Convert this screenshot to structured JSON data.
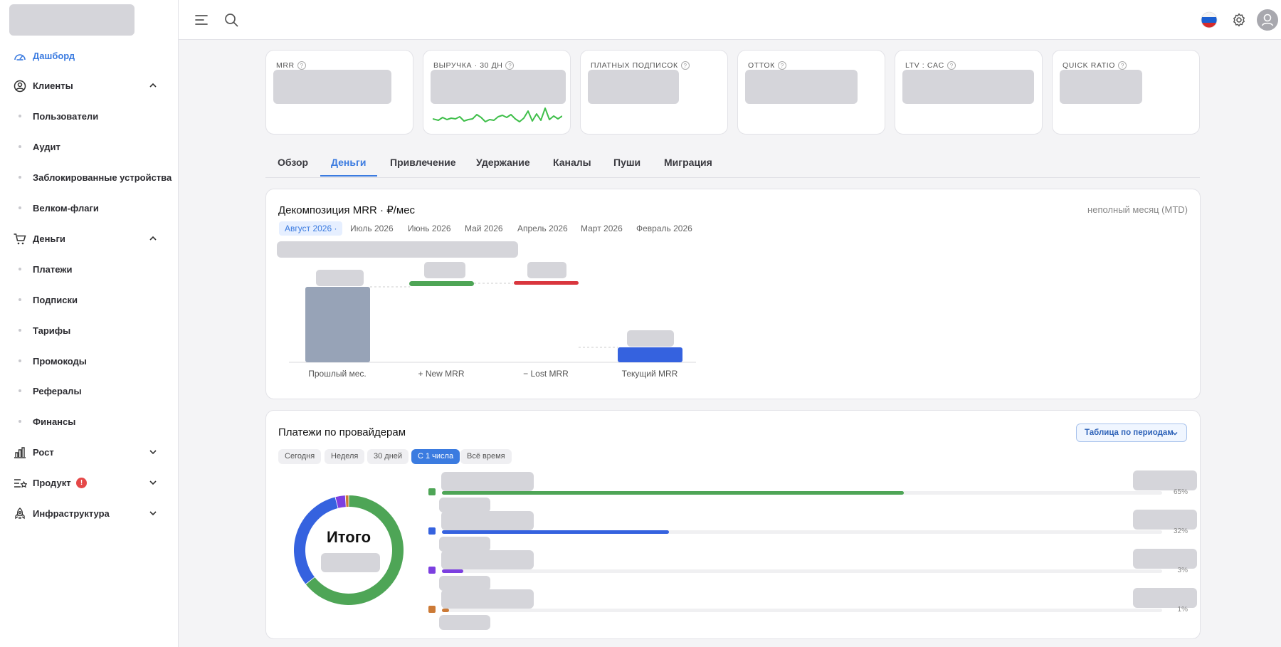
{
  "sidebar": {
    "items": [
      {
        "label": "Дашборд"
      },
      {
        "label": "Клиенты"
      },
      {
        "label": "Пользователи"
      },
      {
        "label": "Аудит"
      },
      {
        "label": "Заблокированные устройства"
      },
      {
        "label": "Велком-флаги"
      },
      {
        "label": "Деньги"
      },
      {
        "label": "Платежи"
      },
      {
        "label": "Подписки"
      },
      {
        "label": "Тарифы"
      },
      {
        "label": "Промокоды"
      },
      {
        "label": "Рефералы"
      },
      {
        "label": "Финансы"
      },
      {
        "label": "Рост"
      },
      {
        "label": "Продукт"
      },
      {
        "label": "Инфраструктура"
      }
    ],
    "product_badge": "!"
  },
  "kpis": [
    {
      "title": "MRR"
    },
    {
      "title": "ВЫРУЧКА · 30 ДН"
    },
    {
      "title": "ПЛАТНЫХ ПОДПИСОК"
    },
    {
      "title": "ОТТОК"
    },
    {
      "title": "LTV : CAC"
    },
    {
      "title": "QUICK RATIO"
    }
  ],
  "help_glyph": "?",
  "tabs": [
    {
      "label": "Обзор"
    },
    {
      "label": "Деньги"
    },
    {
      "label": "Привлечение"
    },
    {
      "label": "Удержание"
    },
    {
      "label": "Каналы"
    },
    {
      "label": "Пуши"
    },
    {
      "label": "Миграция"
    }
  ],
  "mrr_card": {
    "title": "Декомпозиция MRR · ₽/мес",
    "note": "неполный месяц (MTD)",
    "months": [
      "Август 2026 ·",
      "Июль 2026",
      "Июнь 2026",
      "Май 2026",
      "Апрель 2026",
      "Март 2026",
      "Февраль 2026"
    ],
    "axis": [
      "Прошлый мес.",
      "+ New MRR",
      "− Lost MRR",
      "Текущий MRR"
    ]
  },
  "providers_card": {
    "title": "Платежи по провайдерам",
    "button": "Таблица по периодам",
    "periods": [
      "Сегодня",
      "Неделя",
      "30 дней",
      "С 1 числа",
      "Всё время"
    ],
    "donut_label": "Итого",
    "rows": [
      {
        "percent": 65,
        "percent_label": "65%",
        "color": "#4ea556"
      },
      {
        "percent": 32,
        "percent_label": "32%",
        "color": "#3562df"
      },
      {
        "percent": 3,
        "percent_label": "3%",
        "color": "#7c3fe0"
      },
      {
        "percent": 1,
        "percent_label": "1%",
        "color": "#cc7a36"
      }
    ]
  },
  "colors": {
    "accent": "#3b7be0",
    "new_mrr": "#4ea556",
    "lost_mrr": "#d9363e",
    "current_mrr": "#3562df",
    "previous_mrr": "#97a3b7",
    "sparkline": "#3fbf4a"
  }
}
